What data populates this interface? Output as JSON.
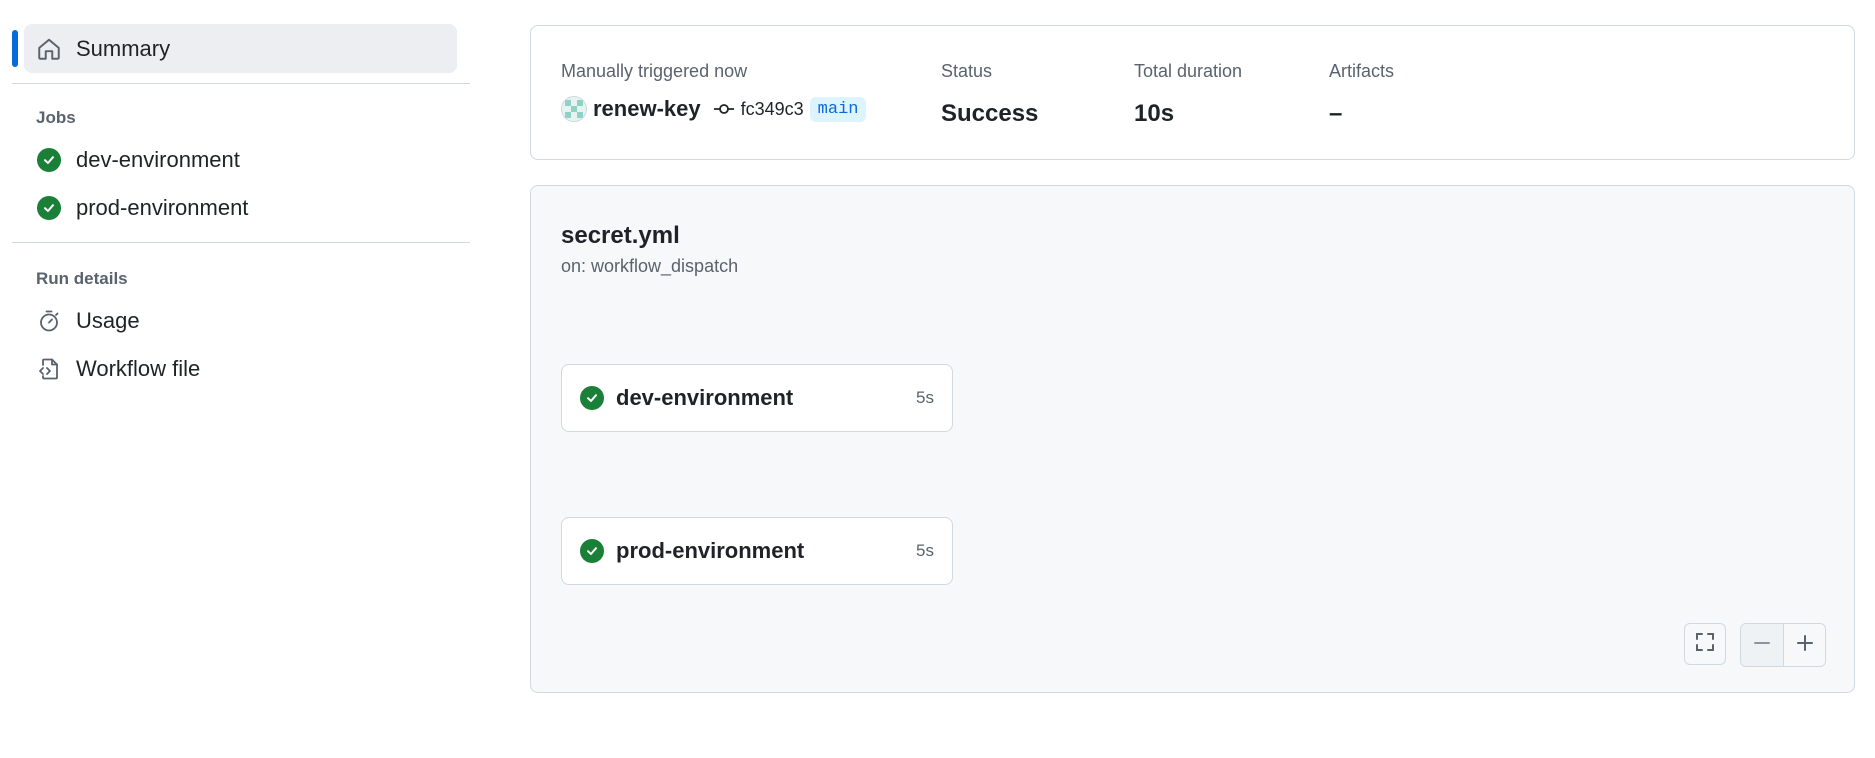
{
  "sidebar": {
    "summary_label": "Summary",
    "jobs_title": "Jobs",
    "jobs": [
      {
        "label": "dev-environment",
        "icon": "check-circle-icon"
      },
      {
        "label": "prod-environment",
        "icon": "check-circle-icon"
      }
    ],
    "run_details_title": "Run details",
    "run_details": [
      {
        "label": "Usage",
        "icon": "stopwatch-icon"
      },
      {
        "label": "Workflow file",
        "icon": "file-code-icon"
      }
    ]
  },
  "summary": {
    "trigger_label": "Manually triggered now",
    "actor": "renew-key",
    "commit": "fc349c3",
    "branch": "main",
    "status_label": "Status",
    "status_value": "Success",
    "duration_label": "Total duration",
    "duration_value": "10s",
    "artifacts_label": "Artifacts",
    "artifacts_value": "–"
  },
  "workflow": {
    "file": "secret.yml",
    "trigger": "on: workflow_dispatch",
    "jobs": [
      {
        "name": "dev-environment",
        "duration": "5s"
      },
      {
        "name": "prod-environment",
        "duration": "5s"
      }
    ]
  },
  "colors": {
    "accent": "#0969da",
    "success": "#1a7f37",
    "branch_bg": "#ddf4ff"
  }
}
